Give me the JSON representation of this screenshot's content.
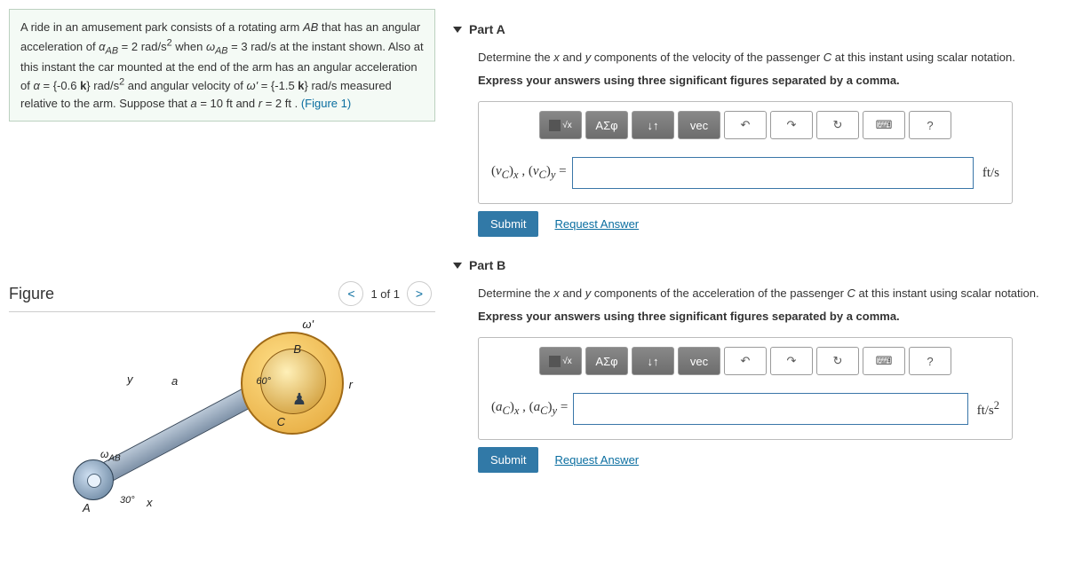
{
  "problem": {
    "text_html": "A ride in an amusement park consists of a rotating arm <i>AB</i> that has an angular acceleration of <i>α<sub>AB</sub></i> = 2 rad/s² when <i>ω<sub>AB</sub></i> = 3 rad/s at the instant shown. Also at this instant the car mounted at the end of the arm has an angular acceleration of <i>α</i> = {-0.6 <b>k</b>} rad/s² and angular velocity of <i>ω'</i> = {-1.5 <b>k</b>} rad/s measured relative to the arm. Suppose that <i>a</i> = 10 ft and <i>r</i> = 2 ft . ",
    "figure_link": "(Figure 1)"
  },
  "figure": {
    "title": "Figure",
    "counter": "1 of 1",
    "labels": {
      "A": "A",
      "B": "B",
      "C": "C",
      "r": "r",
      "a": "a",
      "y": "y",
      "x": "x",
      "omega_prime": "ω'",
      "angle30": "30°",
      "angle60": "60°",
      "omega_ab": "ω_AB"
    }
  },
  "toolbar": {
    "greek": "ΑΣφ",
    "subsup": "↓↑",
    "vec": "vec",
    "undo": "↶",
    "redo": "↷",
    "reset": "↻",
    "keyboard": "⌨",
    "help": "?"
  },
  "partA": {
    "title": "Part A",
    "prompt1": "Determine the x and y components of the velocity of the passenger C at this instant using scalar notation.",
    "prompt2": "Express your answers using three significant figures separated by a comma.",
    "lhs": "(v_C)_x , (v_C)_y =",
    "unit": "ft/s",
    "submit": "Submit",
    "request": "Request Answer"
  },
  "partB": {
    "title": "Part B",
    "prompt1": "Determine the x and y components of the acceleration of the passenger C at this instant using scalar notation.",
    "prompt2": "Express your answers using three significant figures separated by a comma.",
    "lhs": "(a_C)_x , (a_C)_y =",
    "unit": "ft/s²",
    "submit": "Submit",
    "request": "Request Answer"
  }
}
